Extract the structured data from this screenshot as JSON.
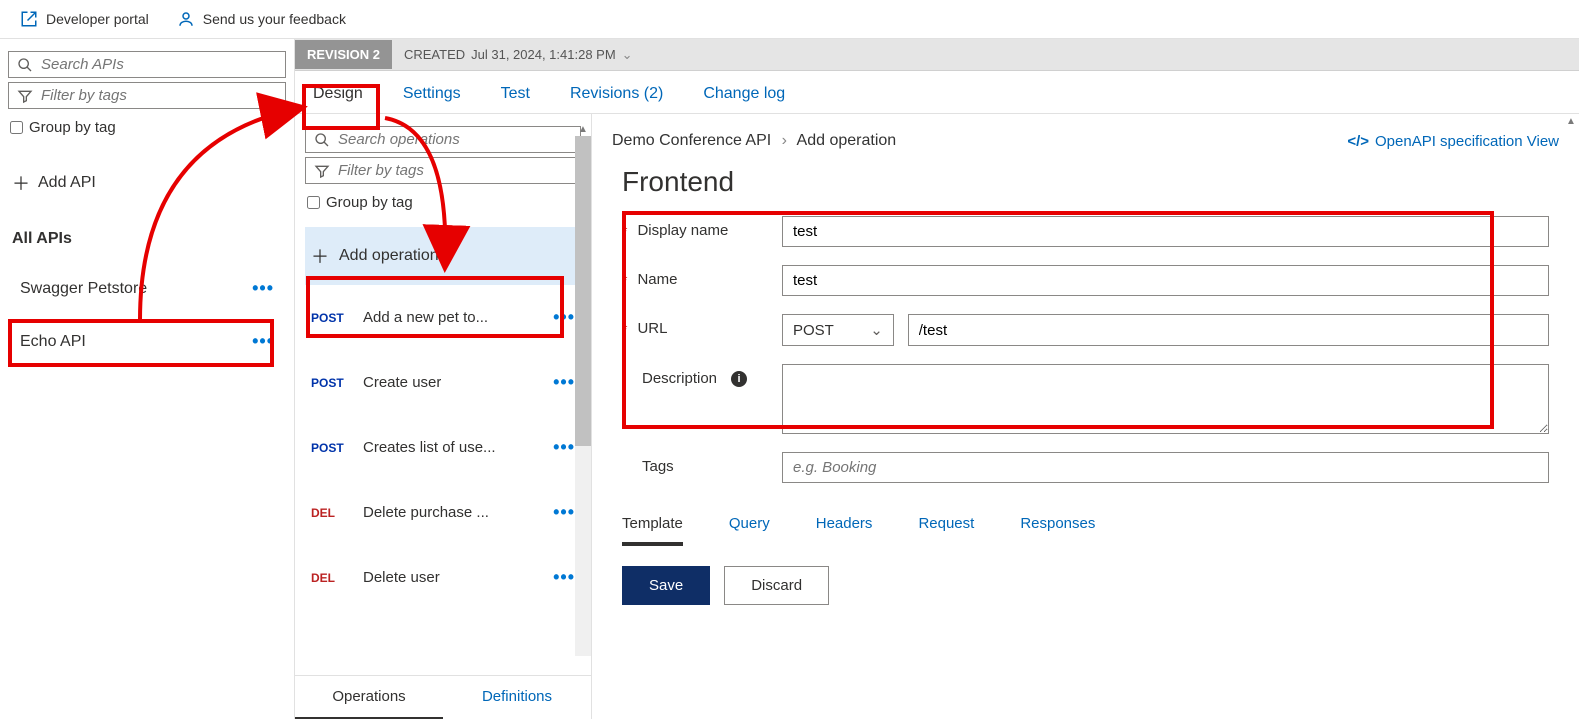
{
  "topbar": {
    "dev_portal": "Developer portal",
    "feedback": "Send us your feedback"
  },
  "sidebar": {
    "search_placeholder": "Search APIs",
    "filter_placeholder": "Filter by tags",
    "group_by_tag": "Group by tag",
    "add_api": "Add API",
    "all_apis": "All APIs",
    "items": [
      {
        "label": "Swagger Petstore"
      },
      {
        "label": "Echo API"
      }
    ]
  },
  "revision": {
    "badge": "REVISION 2",
    "created_label": "CREATED",
    "created_value": "Jul 31, 2024, 1:41:28 PM"
  },
  "tabs": {
    "design": "Design",
    "settings": "Settings",
    "test": "Test",
    "revisions": "Revisions (2)",
    "changelog": "Change log"
  },
  "operations": {
    "search_placeholder": "Search operations",
    "filter_placeholder": "Filter by tags",
    "group_by_tag": "Group by tag",
    "add_operation": "Add operation",
    "items": [
      {
        "method": "POST",
        "name": "Add a new pet to..."
      },
      {
        "method": "POST",
        "name": "Create user"
      },
      {
        "method": "POST",
        "name": "Creates list of use..."
      },
      {
        "method": "DEL",
        "name": "Delete purchase ..."
      },
      {
        "method": "DEL",
        "name": "Delete user"
      }
    ],
    "bottom_tabs": {
      "operations": "Operations",
      "definitions": "Definitions"
    }
  },
  "main": {
    "breadcrumb_api": "Demo Conference API",
    "breadcrumb_page": "Add operation",
    "openapi_link": "OpenAPI specification View",
    "frontend": {
      "title": "Frontend",
      "display_name_label": "Display name",
      "display_name_value": "test",
      "name_label": "Name",
      "name_value": "test",
      "url_label": "URL",
      "url_method": "POST",
      "url_path": "/test",
      "description_label": "Description",
      "description_value": "",
      "tags_label": "Tags",
      "tags_placeholder": "e.g. Booking"
    },
    "subtabs": {
      "template": "Template",
      "query": "Query",
      "headers": "Headers",
      "request": "Request",
      "responses": "Responses"
    },
    "buttons": {
      "save": "Save",
      "discard": "Discard"
    }
  }
}
